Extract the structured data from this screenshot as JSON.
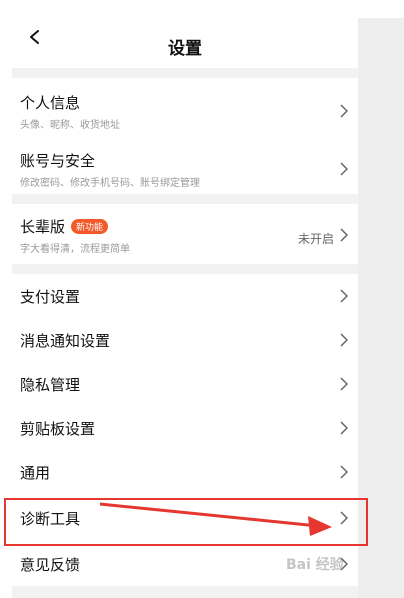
{
  "header": {
    "title": "设置",
    "back_icon": "chevron-left-icon"
  },
  "sections": [
    {
      "items": [
        {
          "label": "个人信息",
          "sub": "头像、昵称、收货地址"
        },
        {
          "label": "账号与安全",
          "sub": "修改密码、修改手机号码、账号绑定管理"
        }
      ]
    },
    {
      "items": [
        {
          "label": "长辈版",
          "badge": "新功能",
          "sub": "字大看得清，流程更简单",
          "status": "未开启"
        }
      ]
    },
    {
      "items": [
        {
          "label": "支付设置"
        },
        {
          "label": "消息通知设置"
        },
        {
          "label": "隐私管理"
        },
        {
          "label": "剪贴板设置"
        },
        {
          "label": "通用"
        },
        {
          "label": "诊断工具"
        },
        {
          "label": "意见反馈"
        }
      ]
    }
  ],
  "watermark": "Bai 经验",
  "colors": {
    "accent": "#f25a2a",
    "highlight_border": "#e5372f"
  }
}
